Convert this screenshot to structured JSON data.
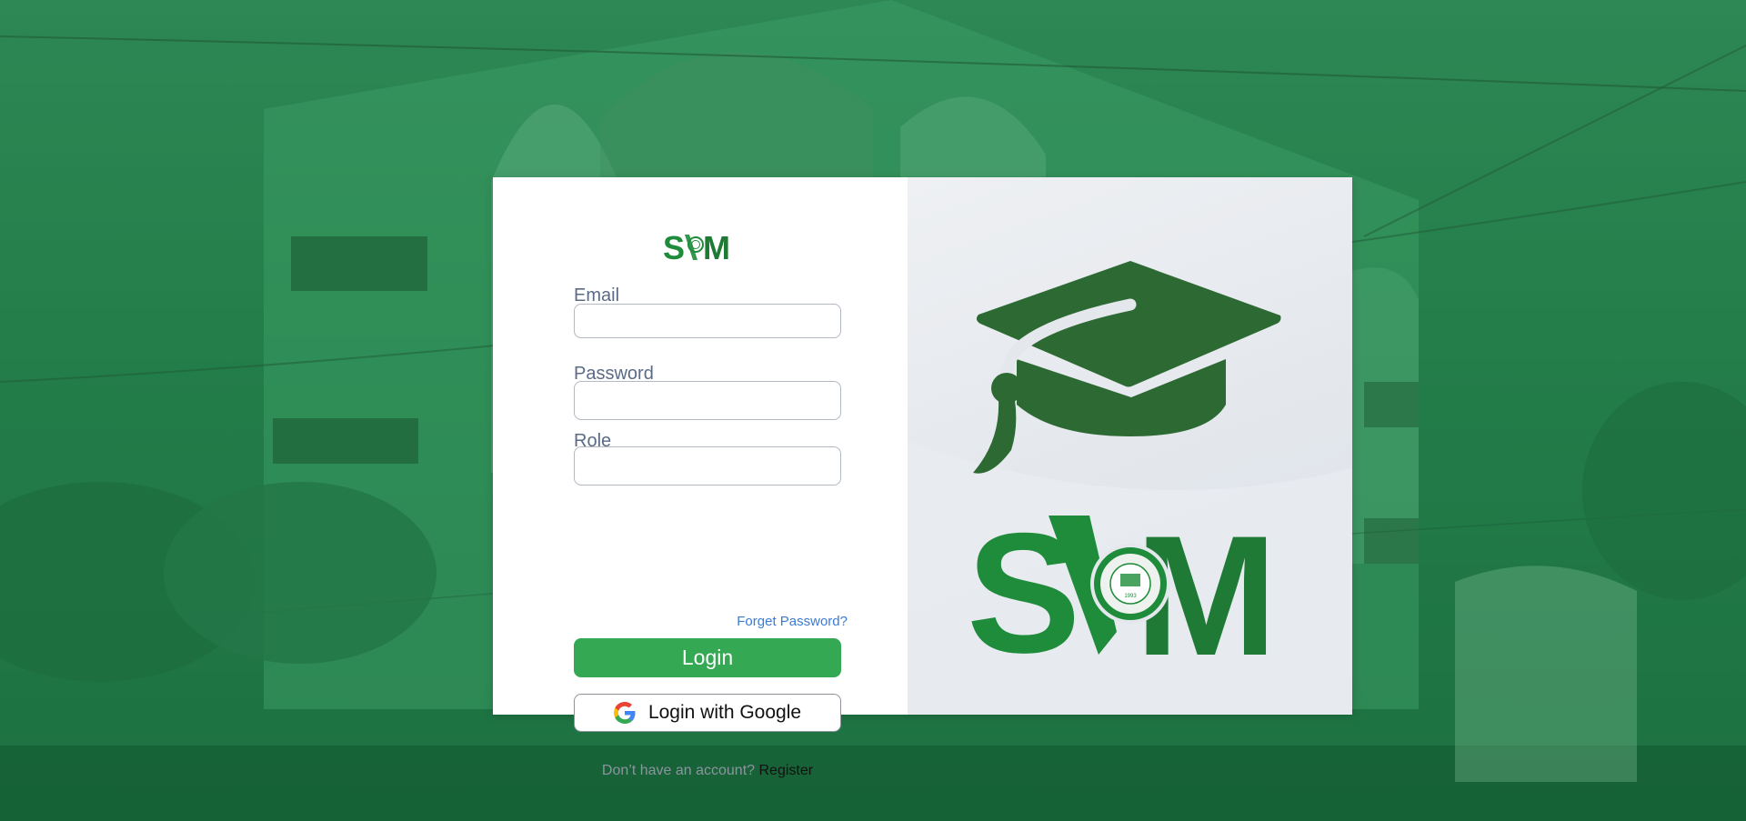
{
  "brand": {
    "name": "SVM",
    "seal_text": "ST. VINCENT MONTESSORI",
    "seal_year": "1993",
    "primary_color": "#1e8c3a",
    "dark_green": "#2d6a33"
  },
  "login_form": {
    "email_label": "Email",
    "email_value": "",
    "password_label": "Password",
    "password_value": "",
    "role_label": "Role",
    "role_value": "",
    "forgot_password": "Forget Password?",
    "login_button": "Login",
    "google_button": "Login with Google",
    "no_account_text": "Don’t have an account?",
    "register_link": "Register"
  },
  "colors": {
    "login_button": "#34a853",
    "link": "#3a7bd5",
    "label": "#5b6b86"
  },
  "icons": {
    "google": "google-icon",
    "graduation_cap": "graduation-cap-icon"
  }
}
